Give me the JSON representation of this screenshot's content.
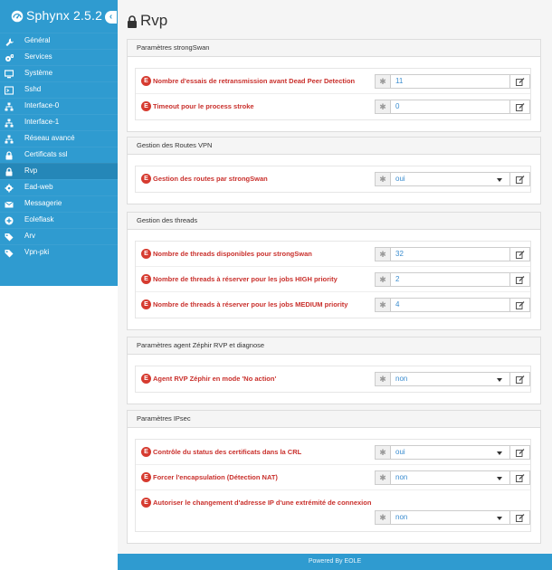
{
  "app": {
    "title": "Sphynx 2.5.2",
    "collapse_glyph": "‹"
  },
  "sidebar": {
    "items": [
      {
        "label": "Général",
        "icon": "wrench-icon"
      },
      {
        "label": "Services",
        "icon": "gears-icon"
      },
      {
        "label": "Système",
        "icon": "desktop-icon"
      },
      {
        "label": "Sshd",
        "icon": "terminal-icon"
      },
      {
        "label": "Interface-0",
        "icon": "sitemap-icon"
      },
      {
        "label": "Interface-1",
        "icon": "sitemap-icon"
      },
      {
        "label": "Réseau avancé",
        "icon": "sitemap-icon"
      },
      {
        "label": "Certificats ssl",
        "icon": "lock-icon"
      },
      {
        "label": "Rvp",
        "icon": "lock-icon",
        "active": true
      },
      {
        "label": "Ead-web",
        "icon": "gear-icon"
      },
      {
        "label": "Messagerie",
        "icon": "envelope-icon"
      },
      {
        "label": "Eoleflask",
        "icon": "plus-icon"
      },
      {
        "label": "Arv",
        "icon": "tags-icon"
      },
      {
        "label": "Vpn-pki",
        "icon": "tags-icon"
      }
    ]
  },
  "page": {
    "title": "Rvp"
  },
  "sections": [
    {
      "title": "Paramètres strongSwan",
      "fields": [
        {
          "label": "Nombre d'essais de retransmission avant Dead Peer Detection",
          "value": "11",
          "type": "text"
        },
        {
          "label": "Timeout pour le process stroke",
          "value": "0",
          "type": "text"
        }
      ]
    },
    {
      "title": "Gestion des Routes VPN",
      "fields": [
        {
          "label": "Gestion des routes par strongSwan",
          "value": "oui",
          "type": "select"
        }
      ]
    },
    {
      "title": "Gestion des threads",
      "fields": [
        {
          "label": "Nombre de threads disponibles pour strongSwan",
          "value": "32",
          "type": "text"
        },
        {
          "label": "Nombre de threads à réserver pour les jobs HIGH priority",
          "value": "2",
          "type": "text"
        },
        {
          "label": "Nombre de threads à réserver pour les jobs MEDIUM priority",
          "value": "4",
          "type": "text"
        }
      ]
    },
    {
      "title": "Paramètres agent Zéphir RVP et diagnose",
      "fields": [
        {
          "label": "Agent RVP Zéphir en mode 'No action'",
          "value": "non",
          "type": "select"
        }
      ]
    },
    {
      "title": "Paramètres IPsec",
      "fields": [
        {
          "label": "Contrôle du status des certificats dans la CRL",
          "value": "oui",
          "type": "select"
        },
        {
          "label": "Forcer l'encapsulation (Détection NAT)",
          "value": "non",
          "type": "select"
        },
        {
          "label": "Autoriser le changement d'adresse IP d'une extrémité de connexion",
          "value": "non",
          "type": "select"
        }
      ]
    }
  ],
  "glyphs": {
    "error": "E",
    "star": "✱"
  },
  "footer": {
    "text": "Powered By EOLE"
  },
  "colors": {
    "primary": "#2f9bd0",
    "active": "#2587b8",
    "error": "#d63b30",
    "label": "#c9302c",
    "value": "#3a8ccf"
  }
}
